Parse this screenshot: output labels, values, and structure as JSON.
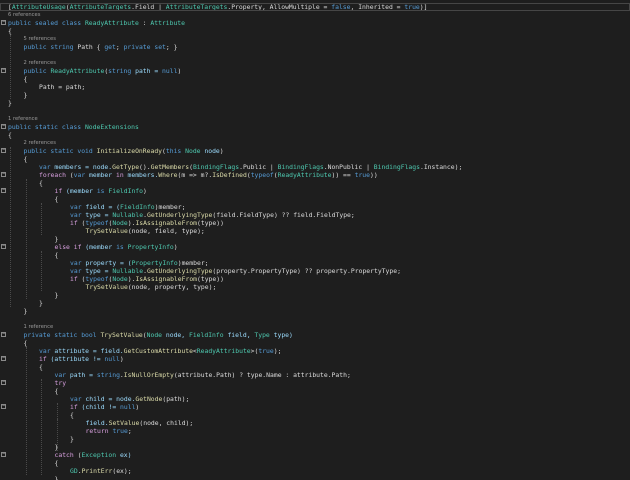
{
  "editor": {
    "colors": {
      "background": "#1e1e1e",
      "keyword": "#569cd6",
      "control": "#d8a0df",
      "type": "#4ec9b0",
      "method": "#dcdcaa",
      "variable": "#9cdcfe",
      "string": "#d69d85",
      "plain": "#dcdcdc",
      "reference": "#999999"
    },
    "lines": [
      {
        "kind": "code",
        "indent": 0,
        "fold": "",
        "spans": [
          [
            "[",
            "p"
          ],
          [
            "AttributeUsage",
            "t"
          ],
          [
            "(",
            "p"
          ],
          [
            "AttributeTargets",
            "t"
          ],
          [
            ".Field | ",
            "p"
          ],
          [
            "AttributeTargets",
            "t"
          ],
          [
            ".Property, AllowMultiple = ",
            "p"
          ],
          [
            "false",
            "k"
          ],
          [
            ", Inherited = ",
            "p"
          ],
          [
            "true",
            "k"
          ],
          [
            ")]",
            "p"
          ]
        ]
      },
      {
        "kind": "ref",
        "indent": 0,
        "text": "6 references"
      },
      {
        "kind": "code",
        "indent": 0,
        "fold": "-",
        "spans": [
          [
            "public sealed class ",
            "k"
          ],
          [
            "ReadyAttribute",
            "t"
          ],
          [
            " : ",
            "p"
          ],
          [
            "Attribute",
            "t"
          ]
        ]
      },
      {
        "kind": "code",
        "indent": 0,
        "fold": "",
        "spans": [
          [
            "{",
            "p"
          ]
        ]
      },
      {
        "kind": "ref",
        "indent": 1,
        "text": "5 references"
      },
      {
        "kind": "code",
        "indent": 1,
        "fold": "",
        "spans": [
          [
            "public string ",
            "k"
          ],
          [
            "Path { ",
            "p"
          ],
          [
            "get",
            "k"
          ],
          [
            "; ",
            "p"
          ],
          [
            "private set",
            "k"
          ],
          [
            "; }",
            "p"
          ]
        ]
      },
      {
        "kind": "blank"
      },
      {
        "kind": "ref",
        "indent": 1,
        "text": "2 references"
      },
      {
        "kind": "code",
        "indent": 1,
        "fold": "-",
        "spans": [
          [
            "public ",
            "k"
          ],
          [
            "ReadyAttribute",
            "t"
          ],
          [
            "(",
            "p"
          ],
          [
            "string ",
            "k"
          ],
          [
            "path = ",
            "v"
          ],
          [
            "null",
            "k"
          ],
          [
            ")",
            "p"
          ]
        ]
      },
      {
        "kind": "code",
        "indent": 1,
        "fold": "",
        "spans": [
          [
            "{",
            "p"
          ]
        ]
      },
      {
        "kind": "code",
        "indent": 2,
        "fold": "",
        "spans": [
          [
            "Path = path;",
            "p"
          ]
        ]
      },
      {
        "kind": "code",
        "indent": 1,
        "fold": "",
        "spans": [
          [
            "}",
            "p"
          ]
        ]
      },
      {
        "kind": "code",
        "indent": 0,
        "fold": "",
        "spans": [
          [
            "}",
            "p"
          ]
        ]
      },
      {
        "kind": "blank"
      },
      {
        "kind": "ref",
        "indent": 0,
        "text": "1 reference"
      },
      {
        "kind": "code",
        "indent": 0,
        "fold": "-",
        "spans": [
          [
            "public static class ",
            "k"
          ],
          [
            "NodeExtensions",
            "t"
          ]
        ]
      },
      {
        "kind": "code",
        "indent": 0,
        "fold": "",
        "spans": [
          [
            "{",
            "p"
          ]
        ]
      },
      {
        "kind": "ref",
        "indent": 1,
        "text": "2 references"
      },
      {
        "kind": "code",
        "indent": 1,
        "fold": "-",
        "spans": [
          [
            "public static void ",
            "k"
          ],
          [
            "InitializeOnReady",
            "m"
          ],
          [
            "(",
            "p"
          ],
          [
            "this ",
            "k"
          ],
          [
            "Node",
            "t"
          ],
          [
            " ",
            "p"
          ],
          [
            "node",
            "v"
          ],
          [
            ")",
            "p"
          ]
        ]
      },
      {
        "kind": "code",
        "indent": 1,
        "fold": "",
        "spans": [
          [
            "{",
            "p"
          ]
        ]
      },
      {
        "kind": "code",
        "indent": 2,
        "fold": "",
        "spans": [
          [
            "var ",
            "k"
          ],
          [
            "members = node.",
            "v"
          ],
          [
            "GetType",
            "m"
          ],
          [
            "().",
            "p"
          ],
          [
            "GetMembers",
            "m"
          ],
          [
            "(",
            "p"
          ],
          [
            "BindingFlags",
            "t"
          ],
          [
            ".Public | ",
            "p"
          ],
          [
            "BindingFlags",
            "t"
          ],
          [
            ".NonPublic | ",
            "p"
          ],
          [
            "BindingFlags",
            "t"
          ],
          [
            ".Instance);",
            "p"
          ]
        ]
      },
      {
        "kind": "code",
        "indent": 2,
        "fold": "-",
        "spans": [
          [
            "foreach ",
            "c"
          ],
          [
            "(",
            "p"
          ],
          [
            "var ",
            "k"
          ],
          [
            "member ",
            "v"
          ],
          [
            "in ",
            "c"
          ],
          [
            "members.",
            "v"
          ],
          [
            "Where",
            "m"
          ],
          [
            "(m => m?.",
            "p"
          ],
          [
            "IsDefined",
            "m"
          ],
          [
            "(",
            "p"
          ],
          [
            "typeof",
            "k"
          ],
          [
            "(",
            "p"
          ],
          [
            "ReadyAttribute",
            "t"
          ],
          [
            ")) == ",
            "p"
          ],
          [
            "true",
            "k"
          ],
          [
            "))",
            "p"
          ]
        ]
      },
      {
        "kind": "code",
        "indent": 2,
        "fold": "",
        "spans": [
          [
            "{",
            "p"
          ]
        ]
      },
      {
        "kind": "code",
        "indent": 3,
        "fold": "-",
        "spans": [
          [
            "if ",
            "c"
          ],
          [
            "(member ",
            "v"
          ],
          [
            "is ",
            "k"
          ],
          [
            "FieldInfo",
            "t"
          ],
          [
            ")",
            "p"
          ]
        ]
      },
      {
        "kind": "code",
        "indent": 3,
        "fold": "",
        "spans": [
          [
            "{",
            "p"
          ]
        ]
      },
      {
        "kind": "code",
        "indent": 4,
        "fold": "",
        "spans": [
          [
            "var ",
            "k"
          ],
          [
            "field = (",
            "v"
          ],
          [
            "FieldInfo",
            "t"
          ],
          [
            ")member;",
            "p"
          ]
        ]
      },
      {
        "kind": "code",
        "indent": 4,
        "fold": "",
        "spans": [
          [
            "var ",
            "k"
          ],
          [
            "type = ",
            "v"
          ],
          [
            "Nullable",
            "t"
          ],
          [
            ".",
            "p"
          ],
          [
            "GetUnderlyingType",
            "m"
          ],
          [
            "(field.FieldType) ?? field.FieldType;",
            "p"
          ]
        ]
      },
      {
        "kind": "code",
        "indent": 4,
        "fold": "",
        "spans": [
          [
            "if ",
            "c"
          ],
          [
            "(",
            "p"
          ],
          [
            "typeof",
            "k"
          ],
          [
            "(",
            "p"
          ],
          [
            "Node",
            "t"
          ],
          [
            ").",
            "p"
          ],
          [
            "IsAssignableFrom",
            "m"
          ],
          [
            "(type))",
            "p"
          ]
        ]
      },
      {
        "kind": "code",
        "indent": 5,
        "fold": "",
        "spans": [
          [
            "TrySetValue",
            "m"
          ],
          [
            "(node, field, type);",
            "p"
          ]
        ]
      },
      {
        "kind": "code",
        "indent": 3,
        "fold": "",
        "spans": [
          [
            "}",
            "p"
          ]
        ]
      },
      {
        "kind": "code",
        "indent": 3,
        "fold": "-",
        "spans": [
          [
            "else if ",
            "c"
          ],
          [
            "(member ",
            "v"
          ],
          [
            "is ",
            "k"
          ],
          [
            "PropertyInfo",
            "t"
          ],
          [
            ")",
            "p"
          ]
        ]
      },
      {
        "kind": "code",
        "indent": 3,
        "fold": "",
        "spans": [
          [
            "{",
            "p"
          ]
        ]
      },
      {
        "kind": "code",
        "indent": 4,
        "fold": "",
        "spans": [
          [
            "var ",
            "k"
          ],
          [
            "property = (",
            "v"
          ],
          [
            "PropertyInfo",
            "t"
          ],
          [
            ")member;",
            "p"
          ]
        ]
      },
      {
        "kind": "code",
        "indent": 4,
        "fold": "",
        "spans": [
          [
            "var ",
            "k"
          ],
          [
            "type = ",
            "v"
          ],
          [
            "Nullable",
            "t"
          ],
          [
            ".",
            "p"
          ],
          [
            "GetUnderlyingType",
            "m"
          ],
          [
            "(property.PropertyType) ?? property.PropertyType;",
            "p"
          ]
        ]
      },
      {
        "kind": "code",
        "indent": 4,
        "fold": "",
        "spans": [
          [
            "if ",
            "c"
          ],
          [
            "(",
            "p"
          ],
          [
            "typeof",
            "k"
          ],
          [
            "(",
            "p"
          ],
          [
            "Node",
            "t"
          ],
          [
            ").",
            "p"
          ],
          [
            "IsAssignableFrom",
            "m"
          ],
          [
            "(type))",
            "p"
          ]
        ]
      },
      {
        "kind": "code",
        "indent": 5,
        "fold": "",
        "spans": [
          [
            "TrySetValue",
            "m"
          ],
          [
            "(node, property, type);",
            "p"
          ]
        ]
      },
      {
        "kind": "code",
        "indent": 3,
        "fold": "",
        "spans": [
          [
            "}",
            "p"
          ]
        ]
      },
      {
        "kind": "code",
        "indent": 2,
        "fold": "",
        "spans": [
          [
            "}",
            "p"
          ]
        ]
      },
      {
        "kind": "code",
        "indent": 1,
        "fold": "",
        "spans": [
          [
            "}",
            "p"
          ]
        ]
      },
      {
        "kind": "blank"
      },
      {
        "kind": "ref",
        "indent": 1,
        "text": "1 reference"
      },
      {
        "kind": "code",
        "indent": 1,
        "fold": "-",
        "spans": [
          [
            "private static bool ",
            "k"
          ],
          [
            "TrySetValue",
            "m"
          ],
          [
            "(",
            "p"
          ],
          [
            "Node",
            "t"
          ],
          [
            " node, ",
            "v"
          ],
          [
            "FieldInfo",
            "t"
          ],
          [
            " field, ",
            "v"
          ],
          [
            "Type",
            "t"
          ],
          [
            " type)",
            "v"
          ]
        ]
      },
      {
        "kind": "code",
        "indent": 1,
        "fold": "",
        "spans": [
          [
            "{",
            "p"
          ]
        ]
      },
      {
        "kind": "code",
        "indent": 2,
        "fold": "",
        "spans": [
          [
            "var ",
            "k"
          ],
          [
            "attribute = field.",
            "v"
          ],
          [
            "GetCustomAttribute",
            "m"
          ],
          [
            "<",
            "p"
          ],
          [
            "ReadyAttribute",
            "t"
          ],
          [
            ">(",
            "p"
          ],
          [
            "true",
            "k"
          ],
          [
            ");",
            "p"
          ]
        ]
      },
      {
        "kind": "code",
        "indent": 2,
        "fold": "-",
        "spans": [
          [
            "if ",
            "c"
          ],
          [
            "(attribute != ",
            "v"
          ],
          [
            "null",
            "k"
          ],
          [
            ")",
            "p"
          ]
        ]
      },
      {
        "kind": "code",
        "indent": 2,
        "fold": "",
        "spans": [
          [
            "{",
            "p"
          ]
        ]
      },
      {
        "kind": "code",
        "indent": 3,
        "fold": "",
        "spans": [
          [
            "var ",
            "k"
          ],
          [
            "path = ",
            "v"
          ],
          [
            "string",
            "k"
          ],
          [
            ".",
            "p"
          ],
          [
            "IsNullOrEmpty",
            "m"
          ],
          [
            "(attribute.Path) ? type.Name : attribute.Path;",
            "p"
          ]
        ]
      },
      {
        "kind": "code",
        "indent": 3,
        "fold": "-",
        "spans": [
          [
            "try",
            "c"
          ]
        ]
      },
      {
        "kind": "code",
        "indent": 3,
        "fold": "",
        "spans": [
          [
            "{",
            "p"
          ]
        ]
      },
      {
        "kind": "code",
        "indent": 4,
        "fold": "",
        "spans": [
          [
            "var ",
            "k"
          ],
          [
            "child = node.",
            "v"
          ],
          [
            "GetNode",
            "m"
          ],
          [
            "(path);",
            "p"
          ]
        ]
      },
      {
        "kind": "code",
        "indent": 4,
        "fold": "-",
        "spans": [
          [
            "if ",
            "c"
          ],
          [
            "(child != ",
            "v"
          ],
          [
            "null",
            "k"
          ],
          [
            ")",
            "p"
          ]
        ]
      },
      {
        "kind": "code",
        "indent": 4,
        "fold": "",
        "spans": [
          [
            "{",
            "p"
          ]
        ]
      },
      {
        "kind": "code",
        "indent": 5,
        "fold": "",
        "spans": [
          [
            "field.",
            "v"
          ],
          [
            "SetValue",
            "m"
          ],
          [
            "(node, child);",
            "p"
          ]
        ]
      },
      {
        "kind": "code",
        "indent": 5,
        "fold": "",
        "spans": [
          [
            "return ",
            "c"
          ],
          [
            "true",
            "k"
          ],
          [
            ";",
            "p"
          ]
        ]
      },
      {
        "kind": "code",
        "indent": 4,
        "fold": "",
        "spans": [
          [
            "}",
            "p"
          ]
        ]
      },
      {
        "kind": "code",
        "indent": 3,
        "fold": "",
        "spans": [
          [
            "}",
            "p"
          ]
        ]
      },
      {
        "kind": "code",
        "indent": 3,
        "fold": "-",
        "spans": [
          [
            "catch ",
            "c"
          ],
          [
            "(",
            "p"
          ],
          [
            "Exception",
            "t"
          ],
          [
            " ex)",
            "v"
          ]
        ]
      },
      {
        "kind": "code",
        "indent": 3,
        "fold": "",
        "spans": [
          [
            "{",
            "p"
          ]
        ]
      },
      {
        "kind": "code",
        "indent": 4,
        "fold": "",
        "spans": [
          [
            "GD",
            "t"
          ],
          [
            ".",
            "p"
          ],
          [
            "PrintErr",
            "m"
          ],
          [
            "(ex);",
            "p"
          ]
        ]
      },
      {
        "kind": "code",
        "indent": 3,
        "fold": "",
        "spans": [
          [
            "}",
            "p"
          ]
        ]
      }
    ]
  }
}
